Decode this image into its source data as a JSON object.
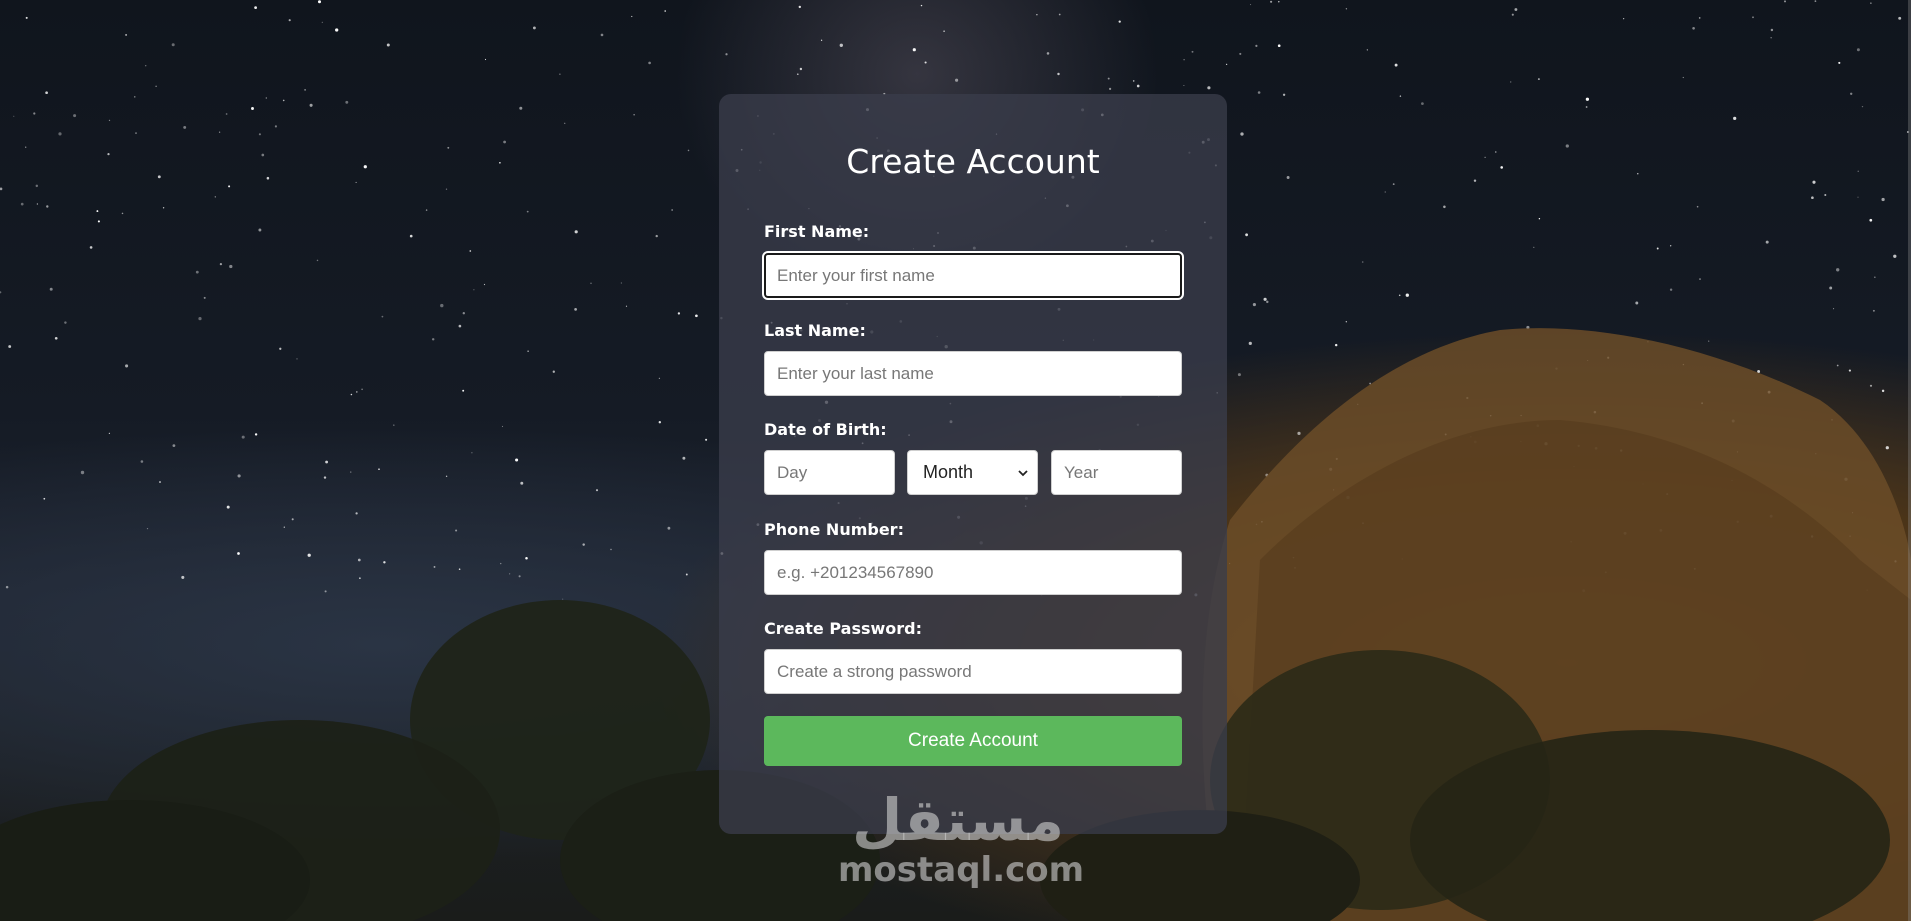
{
  "form": {
    "title": "Create Account",
    "first_name": {
      "label": "First Name:",
      "placeholder": "Enter your first name",
      "value": ""
    },
    "last_name": {
      "label": "Last Name:",
      "placeholder": "Enter your last name",
      "value": ""
    },
    "date_of_birth": {
      "label": "Date of Birth:",
      "day_placeholder": "Day",
      "month_selected": "Month",
      "year_placeholder": "Year"
    },
    "phone": {
      "label": "Phone Number:",
      "placeholder": "e.g. +201234567890",
      "value": ""
    },
    "password": {
      "label": "Create Password:",
      "placeholder": "Create a strong password",
      "value": ""
    },
    "submit_label": "Create Account"
  },
  "watermark": {
    "arabic": "مستقل",
    "latin": "mostaql.com"
  },
  "colors": {
    "submit_button": "#5cb85c",
    "card_background": "#3a3c4a",
    "label_text": "#ffffff"
  },
  "icons": {
    "month_dropdown": "chevron-down-icon"
  }
}
